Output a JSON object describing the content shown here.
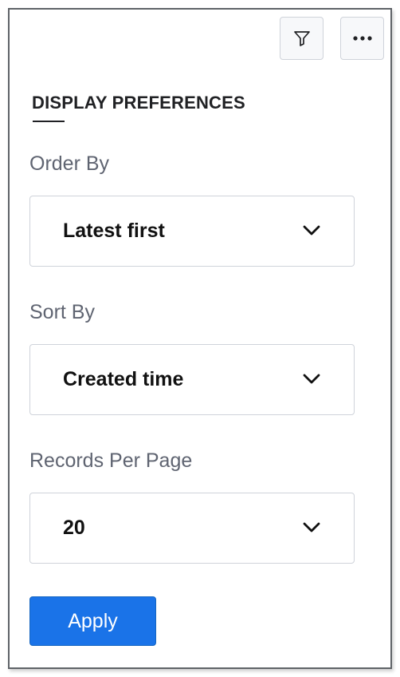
{
  "header": {
    "filter_icon": "filter-icon",
    "more_icon": "more-horizontal-icon"
  },
  "section": {
    "title": "DISPLAY PREFERENCES"
  },
  "fields": {
    "order_by": {
      "label": "Order By",
      "value": "Latest first"
    },
    "sort_by": {
      "label": "Sort By",
      "value": "Created time"
    },
    "records_per_page": {
      "label": "Records Per Page",
      "value": "20"
    }
  },
  "actions": {
    "apply_label": "Apply"
  },
  "colors": {
    "accent": "#1a73e8",
    "label": "#5f6471",
    "border": "#cfd3da",
    "panel_border": "#5f6368"
  }
}
